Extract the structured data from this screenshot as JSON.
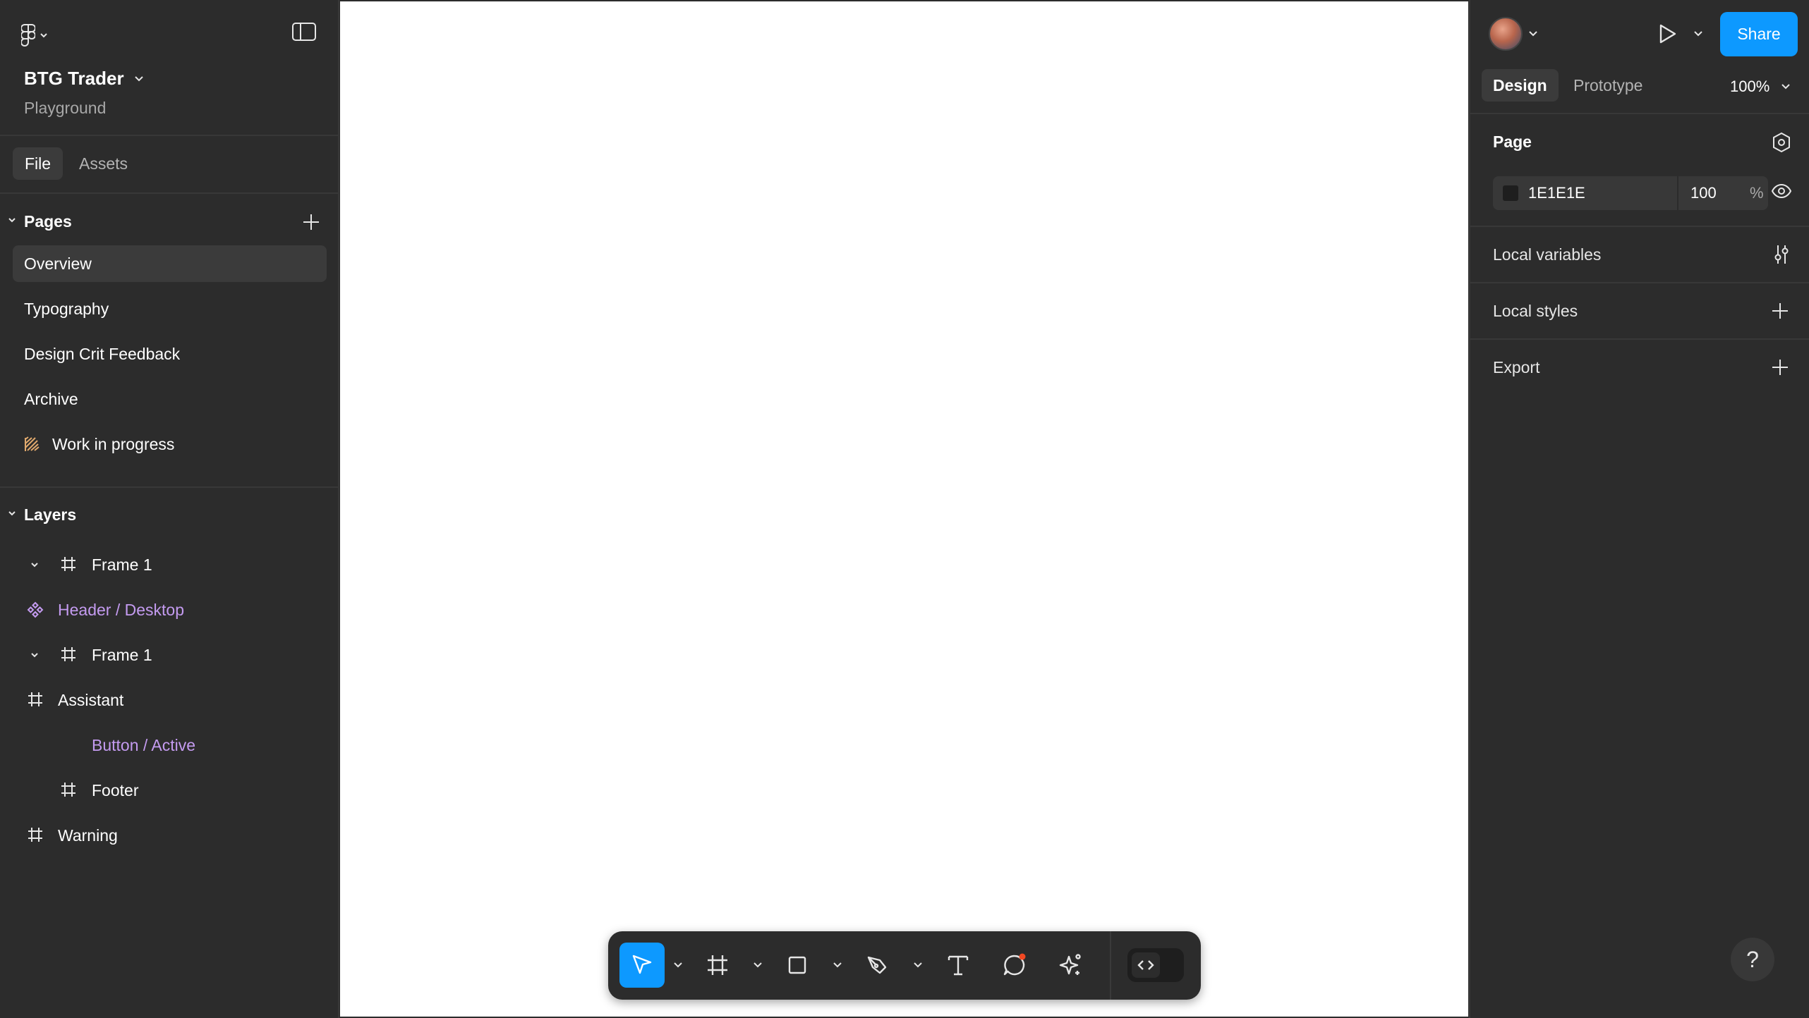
{
  "header": {
    "file_name": "BTG Trader",
    "project": "Playground"
  },
  "left_tabs": [
    {
      "label": "File"
    },
    {
      "label": "Assets"
    }
  ],
  "pages_section": {
    "title": "Pages",
    "items": [
      {
        "label": "Overview",
        "active": true
      },
      {
        "label": "Typography"
      },
      {
        "label": "Design Crit Feedback"
      },
      {
        "label": "Archive"
      },
      {
        "label": "Work in progress",
        "icon": "striped-flag-icon"
      }
    ]
  },
  "layers_section": {
    "title": "Layers",
    "items": [
      {
        "label": "Frame 1",
        "icon": "frame-icon",
        "expanded": true
      },
      {
        "label": "Header / Desktop",
        "icon": "component-icon",
        "component": true
      },
      {
        "label": "Frame 1",
        "icon": "frame-icon",
        "expanded": true
      },
      {
        "label": "Assistant",
        "icon": "frame-icon"
      },
      {
        "label": "Button / Active",
        "component": true
      },
      {
        "label": "Footer",
        "icon": "frame-icon"
      },
      {
        "label": "Warning",
        "icon": "frame-icon"
      }
    ]
  },
  "toolbar": {
    "tools": [
      "move-icon",
      "frame-tool-icon",
      "rectangle-icon",
      "pen-icon",
      "text-icon",
      "comment-icon",
      "ai-sparkle-icon"
    ],
    "dev_mode": "code-icon"
  },
  "right_panel": {
    "share_label": "Share",
    "tabs": [
      {
        "label": "Design",
        "active": true
      },
      {
        "label": "Prototype"
      }
    ],
    "zoom": "100%",
    "page": {
      "title": "Page",
      "bg_hex": "1E1E1E",
      "opacity": "100",
      "opacity_unit": "%"
    },
    "local_variables": "Local variables",
    "local_styles": "Local styles",
    "export": "Export",
    "help": "?"
  },
  "colors": {
    "panel_bg": "#2c2c2c",
    "accent": "#0d99ff",
    "component_purple": "#c49bf0",
    "canvas_bg": "#ffffff"
  }
}
